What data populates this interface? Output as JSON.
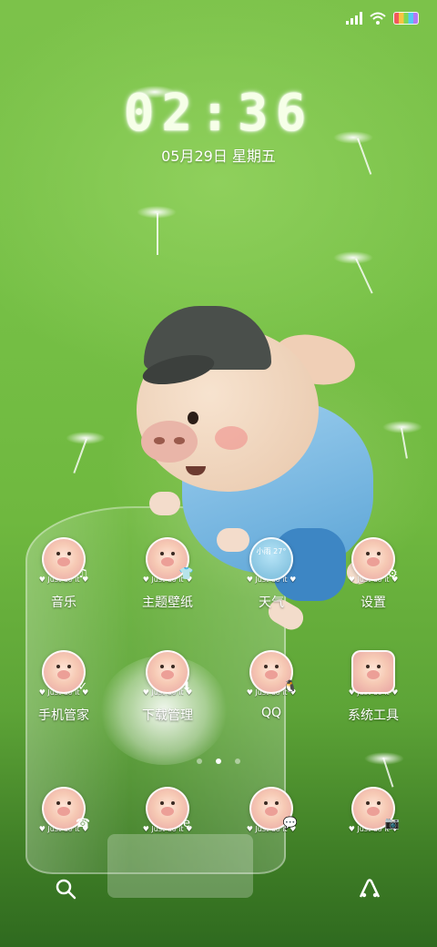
{
  "status": {
    "signal_icon": "signal-icon",
    "wifi_icon": "wifi-icon",
    "battery_icon": "battery-icon"
  },
  "lock": {
    "time": "02:36",
    "date": "05月29日 星期五"
  },
  "apps": [
    {
      "label": "音乐",
      "ribbon": "♥ Just do it ♥",
      "badge": "♫"
    },
    {
      "label": "主题壁纸",
      "ribbon": "♥ Just do it ♥",
      "badge": "👕"
    },
    {
      "label": "天气",
      "ribbon": "♥ Just do it ♥",
      "weather": "小雨 27°"
    },
    {
      "label": "设置",
      "ribbon": "♥ Just do it ♥",
      "badge": "⚙"
    },
    {
      "label": "手机管家",
      "ribbon": "♥ Just do it ♥",
      "badge": "✓"
    },
    {
      "label": "下载管理",
      "ribbon": "♥ Just do it ♥",
      "badge": "⬇"
    },
    {
      "label": "QQ",
      "ribbon": "♥ Just do it ♥",
      "badge": "🐧"
    },
    {
      "label": "系统工具",
      "ribbon": "♥ Just do it ♥"
    }
  ],
  "dock": [
    {
      "ribbon": "♥ Just do it ♥",
      "badge": "☎"
    },
    {
      "ribbon": "♥ Just do it ♥",
      "badge": "e"
    },
    {
      "ribbon": "♥ Just do it ♥",
      "badge": "💬"
    },
    {
      "ribbon": "♥ Just do it ♥",
      "badge": "📷"
    }
  ],
  "page_indicator": {
    "pages": 3,
    "current": 2
  },
  "bottom": {
    "left_icon": "search-icon",
    "right_icon": "app-drawer-icon"
  }
}
